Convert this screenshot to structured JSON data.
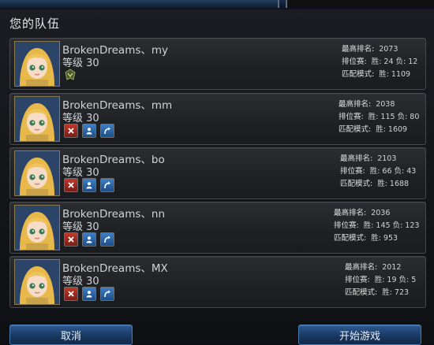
{
  "panel": {
    "title": "您的队伍"
  },
  "members": [
    {
      "name": "BrokenDreams、my",
      "level": "等级 30",
      "is_leader": true,
      "stats": {
        "rank_label": "最高排名:",
        "rank_value": "2073",
        "ranked_label": "排位赛:",
        "ranked_value": "胜: 24 负: 12",
        "normal_label": "匹配模式:",
        "normal_value": "胜: 1109"
      }
    },
    {
      "name": "BrokenDreams、mm",
      "level": "等级 30",
      "is_leader": false,
      "stats": {
        "rank_label": "最高排名:",
        "rank_value": "2038",
        "ranked_label": "排位赛:",
        "ranked_value": "胜: 115 负: 80",
        "normal_label": "匹配模式:",
        "normal_value": "胜: 1609"
      }
    },
    {
      "name": "BrokenDreams、bo",
      "level": "等级 30",
      "is_leader": false,
      "stats": {
        "rank_label": "最高排名:",
        "rank_value": "2103",
        "ranked_label": "排位赛:",
        "ranked_value": "胜: 66 负: 43",
        "normal_label": "匹配模式:",
        "normal_value": "胜: 1688"
      }
    },
    {
      "name": "BrokenDreams、nn",
      "level": "等级 30",
      "is_leader": false,
      "stats": {
        "rank_label": "最高排名:",
        "rank_value": "2036",
        "ranked_label": "排位赛:",
        "ranked_value": "胜: 145 负: 123",
        "normal_label": "匹配模式:",
        "normal_value": "胜: 953"
      }
    },
    {
      "name": "BrokenDreams、MX",
      "level": "等级 30",
      "is_leader": false,
      "stats": {
        "rank_label": "最高排名:",
        "rank_value": "2012",
        "ranked_label": "排位赛:",
        "ranked_value": "胜: 19 负: 5",
        "normal_label": "匹配模式:",
        "normal_value": "胜: 723"
      }
    }
  ],
  "icons": {
    "leader": "team-leader-badge-icon",
    "kick": "kick-x-icon",
    "profile": "player-profile-icon",
    "promote": "promote-arrow-icon"
  },
  "buttons": {
    "cancel": "取消",
    "start": "开始游戏"
  },
  "colors": {
    "kick_button": "#c0392b",
    "blue_button": "#3e7fc6",
    "bottom_button": "#2d5a93"
  }
}
